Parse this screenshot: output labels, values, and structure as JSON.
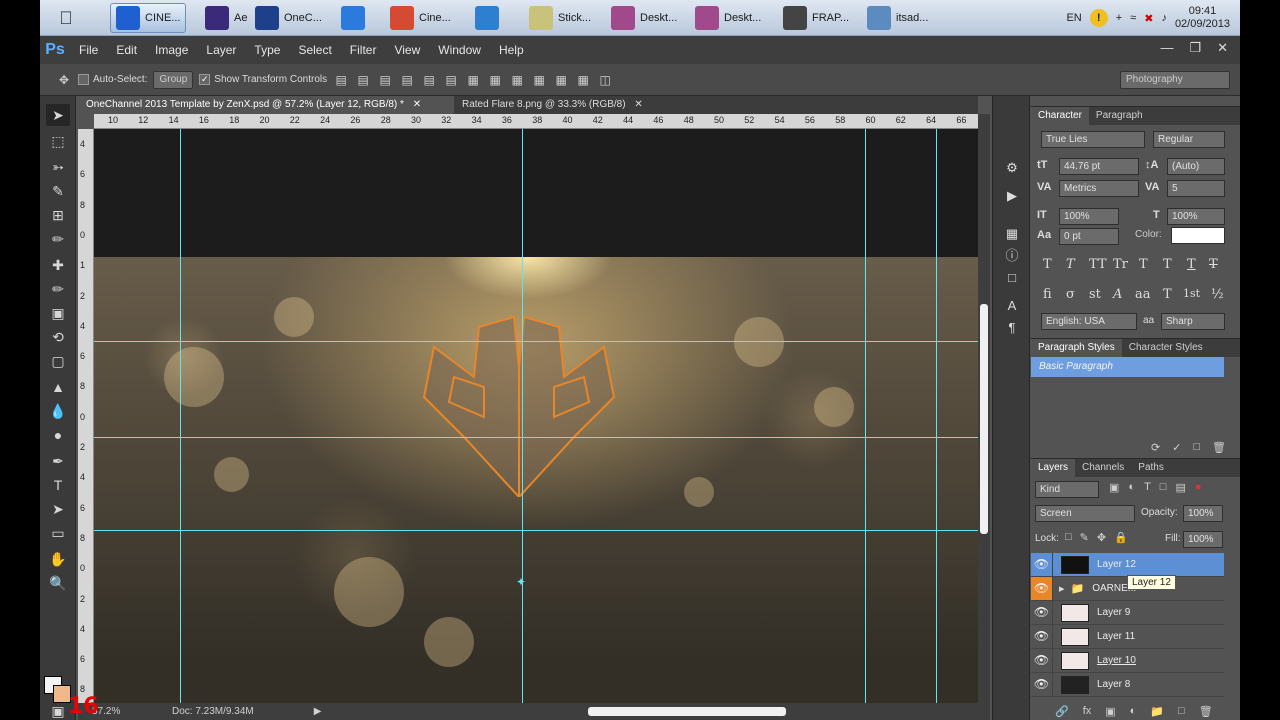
{
  "taskbar": {
    "items": [
      {
        "label": "CINE...",
        "icon": "cinema4d-icon",
        "color": "#1f5fcf"
      },
      {
        "label": "Ae",
        "icon": "after-effects-icon",
        "color": "#3b2a7a"
      },
      {
        "label": "OneC...",
        "icon": "photoshop-icon",
        "color": "#1e3f8a"
      },
      {
        "label": "",
        "icon": "globe-icon",
        "color": "#2a7bdc"
      },
      {
        "label": "Cine...",
        "icon": "chrome-icon",
        "color": "#d44a32"
      },
      {
        "label": "",
        "icon": "pen-icon",
        "color": "#2f7fd1"
      },
      {
        "label": "Stick...",
        "icon": "sticky-notes-icon",
        "color": "#c8c27a"
      },
      {
        "label": "Deskt...",
        "icon": "desktop-icon",
        "color": "#a04a8c"
      },
      {
        "label": "Deskt...",
        "icon": "desktop-icon",
        "color": "#a04a8c"
      },
      {
        "label": "FRAP...",
        "icon": "fraps-icon",
        "color": "#444"
      },
      {
        "label": "itsad...",
        "icon": "folder-icon",
        "color": "#5b8bbf"
      }
    ],
    "lang": "EN",
    "time": "09:41",
    "date": "02/09/2013"
  },
  "menubar": {
    "logo": "Ps",
    "items": [
      "File",
      "Edit",
      "Image",
      "Layer",
      "Type",
      "Select",
      "Filter",
      "View",
      "Window",
      "Help"
    ]
  },
  "options": {
    "auto_select": "Auto-Select:",
    "auto_select_value": "Group",
    "show_transform": "Show Transform Controls",
    "workspace": "Photography"
  },
  "doc_tabs": [
    {
      "label": "OneChannel 2013 Template by ZenX.psd @ 57.2% (Layer 12, RGB/8) *"
    },
    {
      "label": "Rated Flare 8.png @ 33.3% (RGB/8)"
    }
  ],
  "ruler": {
    "top_labels": [
      "10",
      "12",
      "14",
      "16",
      "18",
      "20",
      "22",
      "24",
      "26",
      "28",
      "30",
      "32",
      "34",
      "36",
      "38",
      "40",
      "42",
      "44",
      "46",
      "48",
      "50",
      "52",
      "54",
      "56",
      "58",
      "60",
      "62",
      "64",
      "66"
    ],
    "left_labels": [
      "4",
      "6",
      "8",
      "0",
      "1",
      "2",
      "4",
      "6",
      "8",
      "0",
      "2",
      "4",
      "6",
      "8",
      "0",
      "2",
      "4",
      "6",
      "8"
    ]
  },
  "character": {
    "tabs": [
      "Character",
      "Paragraph"
    ],
    "font_family": "True Lies",
    "font_style": "Regular",
    "size": "44.76 pt",
    "leading": "(Auto)",
    "kerning": "Metrics",
    "tracking": "5",
    "vscale": "100%",
    "hscale": "100%",
    "baseline": "0 pt",
    "color_label": "Color:",
    "language": "English: USA",
    "aa_label": "aa",
    "antialias": "Sharp",
    "type_styles": [
      "T",
      "T",
      "TT",
      "Tr",
      "T",
      "T",
      "T",
      "T"
    ],
    "opentype": [
      "fi",
      "σ",
      "st",
      "A",
      "aa",
      "T",
      "1st",
      "½"
    ]
  },
  "para_styles": {
    "tabs": [
      "Paragraph Styles",
      "Character Styles"
    ],
    "item": "Basic Paragraph"
  },
  "layers": {
    "tabs": [
      "Layers",
      "Channels",
      "Paths"
    ],
    "filter_kind": "Kind",
    "blend_mode": "Screen",
    "opacity_label": "Opacity:",
    "opacity": "100%",
    "lock_label": "Lock:",
    "fill_label": "Fill:",
    "fill": "100%",
    "tooltip": "Layer 12",
    "rows": [
      {
        "name": "Layer 12",
        "selected": true,
        "thumb": "#111111"
      },
      {
        "name": "OARNE...",
        "selected": false,
        "thumb": "folder"
      },
      {
        "name": "Layer 9",
        "selected": false,
        "thumb": "#f3e8e8"
      },
      {
        "name": "Layer 11",
        "selected": false,
        "thumb": "#f3e8e8"
      },
      {
        "name": "Layer 10",
        "selected": false,
        "thumb": "#f3e8e8"
      },
      {
        "name": "Layer 8",
        "selected": false,
        "thumb": "#222222"
      }
    ]
  },
  "status": {
    "zoom": "57.2%",
    "doc": "Doc: 7.23M/9.34M"
  },
  "overlay": {
    "frame_counter": "16"
  },
  "colors": {
    "guide": "#5fe6f0",
    "accent_orange": "#e8862a",
    "selection_blue": "#5c8fd4"
  }
}
